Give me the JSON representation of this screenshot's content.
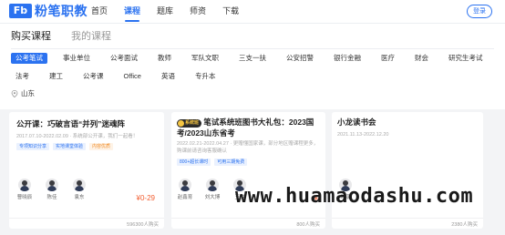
{
  "logo": {
    "mark": "Fb",
    "text": "粉笔职教"
  },
  "nav": {
    "items": [
      {
        "label": "首页",
        "active": false
      },
      {
        "label": "课程",
        "active": true
      },
      {
        "label": "题库",
        "active": false
      },
      {
        "label": "师资",
        "active": false
      },
      {
        "label": "下载",
        "active": false
      }
    ],
    "login": "登录"
  },
  "tabs": {
    "purchase": "购买课程",
    "mine": "我的课程"
  },
  "categories_row1": [
    "公考笔试",
    "事业单位",
    "公考面试",
    "教师",
    "军队文职",
    "三支一扶",
    "公安招警",
    "银行金融",
    "医疗",
    "财会",
    "研究生考试"
  ],
  "categories_row2": [
    "法考",
    "建工",
    "公考课",
    "Office",
    "英语",
    "专升本"
  ],
  "region": "山东",
  "cards": [
    {
      "title": "公开课：巧破言语“并列”迷魂阵",
      "date": "2017.07.10-2022.02.09 · 系统部公开课，我们一起看！",
      "tags": [
        "专项知识分享",
        "实地课堂体验",
        "内容优质"
      ],
      "teachers": [
        "曹晓辰",
        "陈佳",
        "袁东"
      ],
      "price": "¥0-29",
      "buyers": "596300人购买"
    },
    {
      "badge": "系统班",
      "title": "笔试系统班图书大礼包：2023国考/2023山东省考",
      "date": "2022.02.21-2022.04.27 · 更赠懂国家课，部分地区赠课程更多，购课前请咨询客服确认",
      "tags": [
        "800+超长课时",
        "可用三期免费"
      ],
      "teachers": [
        "赵鑫育",
        "刘大博",
        "王俊"
      ],
      "price": "¥",
      "buyers": "800人购买"
    },
    {
      "title": "小龙读书会",
      "date": "2021.11.13-2022.12.20",
      "teachers": [
        "邓康"
      ],
      "buyers": "2380人购买"
    }
  ],
  "watermark": "www.huamaodashu.com",
  "colors": {
    "accent": "#2b72f0",
    "price": "#f25d2f"
  }
}
